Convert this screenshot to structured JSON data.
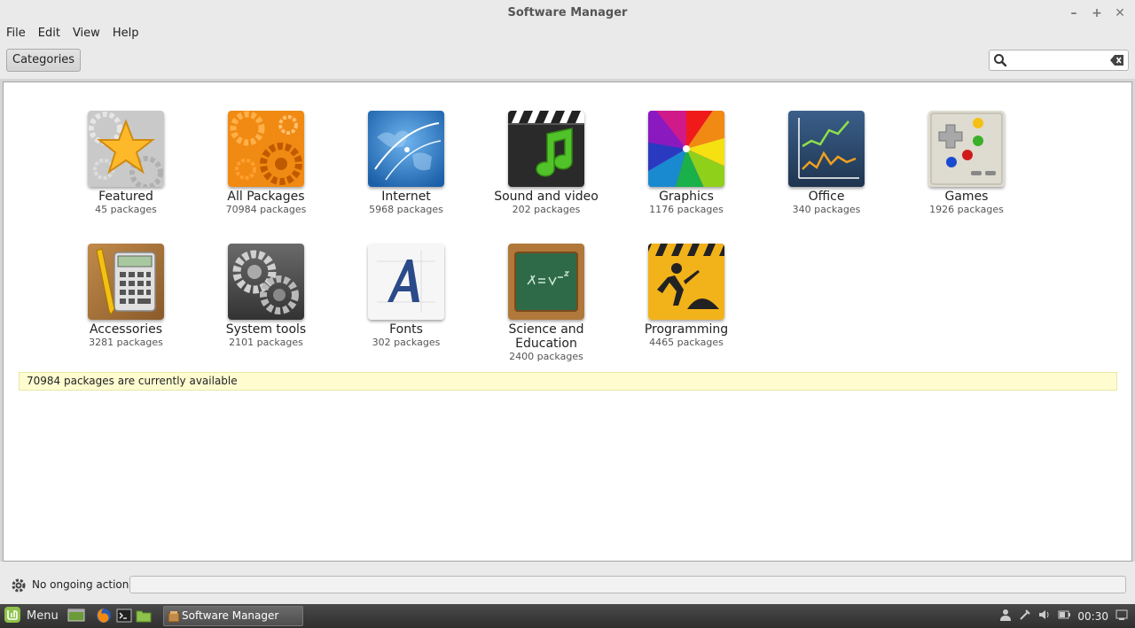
{
  "window": {
    "title": "Software Manager"
  },
  "menubar": {
    "items": [
      "File",
      "Edit",
      "View",
      "Help"
    ]
  },
  "toolbar": {
    "categories_label": "Categories",
    "search_value": ""
  },
  "categories": [
    {
      "name": "Featured",
      "count": "45 packages",
      "icon": "star-gears-icon"
    },
    {
      "name": "All Packages",
      "count": "70984 packages",
      "icon": "orange-gears-icon"
    },
    {
      "name": "Internet",
      "count": "5968 packages",
      "icon": "globe-icon"
    },
    {
      "name": "Sound and video",
      "count": "202 packages",
      "icon": "clapper-note-icon"
    },
    {
      "name": "Graphics",
      "count": "1176 packages",
      "icon": "color-wheel-icon"
    },
    {
      "name": "Office",
      "count": "340 packages",
      "icon": "line-chart-icon"
    },
    {
      "name": "Games",
      "count": "1926 packages",
      "icon": "gamepad-icon"
    },
    {
      "name": "Accessories",
      "count": "3281 packages",
      "icon": "calculator-icon"
    },
    {
      "name": "System tools",
      "count": "2101 packages",
      "icon": "gray-gears-icon"
    },
    {
      "name": "Fonts",
      "count": "302 packages",
      "icon": "font-letter-icon"
    },
    {
      "name": "Science and Education",
      "count": "2400 packages",
      "icon": "chalkboard-icon"
    },
    {
      "name": "Programming",
      "count": "4465 packages",
      "icon": "construction-icon"
    }
  ],
  "infobar": {
    "text": "70984 packages are currently available"
  },
  "statusbar": {
    "text": "No ongoing actions"
  },
  "taskbar": {
    "menu_label": "Menu",
    "task_label": "Software Manager",
    "clock": "00:30"
  },
  "colors": {
    "infobar_bg": "#fffdd0",
    "taskbar_bg": "#3a3a3a",
    "mint_green": "#8fc24a"
  }
}
